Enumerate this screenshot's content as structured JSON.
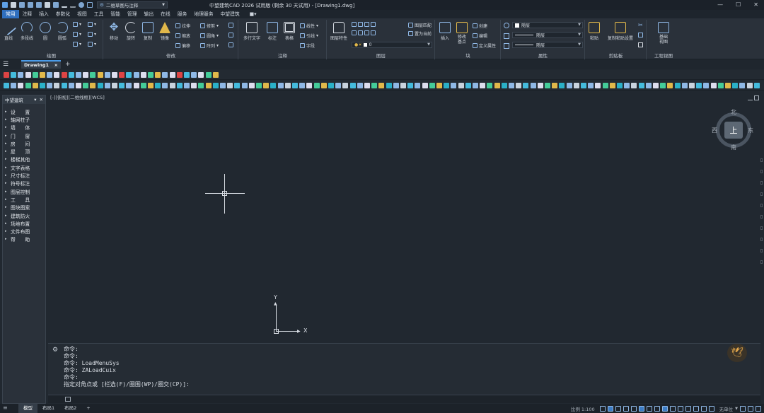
{
  "titlebar": {
    "workspace": "二维草图与注释",
    "title": "中望建筑CAD 2026 试用版 (剩余 30 天试用) - [Drawing1.dwg]",
    "minimize": "—",
    "maximize": "☐",
    "close": "✕"
  },
  "menu": [
    "常用",
    "注释",
    "插入",
    "参数化",
    "视图",
    "工具",
    "智能",
    "管理",
    "输出",
    "在线",
    "服务",
    "地理服务",
    "中望建筑"
  ],
  "ribbon": {
    "draw": {
      "title": "绘图",
      "line": "直线",
      "polyline": "多段线",
      "circle": "圆",
      "arc": "圆弧"
    },
    "modify": {
      "title": "修改",
      "move": "移动",
      "rotate": "旋转",
      "copy": "复制",
      "mirror": "镜像",
      "stretch": "拉伸",
      "scale": "缩放",
      "offset": "偏移",
      "trim": "修剪",
      "fillet": "圆角",
      "array": "阵列"
    },
    "annotate": {
      "title": "注释",
      "mtext": "多行文字",
      "dim": "标注",
      "table": "表格",
      "linear": "线性",
      "leader": "引线",
      "field": "字段"
    },
    "layers": {
      "title": "图层",
      "props": "图层特性",
      "current": "0",
      "match": "图层匹配",
      "setcurrent": "置为当前"
    },
    "block": {
      "title": "块",
      "insert": "插入",
      "edit": "修改\n基点",
      "create": "创建",
      "editattr": "编辑",
      "define": "定义属性"
    },
    "props": {
      "title": "属性",
      "color": "随层",
      "linetype": "随层",
      "lineweight": "随层"
    },
    "clipboard": {
      "title": "剪贴板",
      "paste": "粘贴",
      "copyset": "复制粘贴设置"
    },
    "view": {
      "title": "工程视图",
      "base": "基础\n视图"
    }
  },
  "tabs": {
    "doc": "Drawing1",
    "close": "×",
    "add": "+"
  },
  "sidebar": {
    "title": "中望建筑",
    "items": [
      "设　　置",
      "轴网柱子",
      "墙　　体",
      "门　　窗",
      "房　　间",
      "屋　　顶",
      "楼梯其他",
      "文字表格",
      "尺寸标注",
      "符号标注",
      "图层控制",
      "工　　具",
      "图块图案",
      "建筑防火",
      "场地布置",
      "文件布图",
      "帮　　助"
    ]
  },
  "viewport": {
    "label": "[-][俯视][二维线框][WCS]"
  },
  "viewcube": {
    "top": "上",
    "north": "北",
    "south": "南",
    "east": "东",
    "west": "西"
  },
  "ucs": {
    "x": "X",
    "y": "Y"
  },
  "command": {
    "lines": [
      "命令:",
      "命令:",
      "命令: LoadMenuSys",
      "命令: ZALoadCuix",
      "命令:",
      "指定对角点或 [栏选(F)/圈围(WP)/圈交(CP)]:"
    ]
  },
  "status": {
    "layouts": [
      "模型",
      "布局1",
      "布局2"
    ],
    "add": "+",
    "scale": "比例 1:100",
    "units": "无单位"
  }
}
